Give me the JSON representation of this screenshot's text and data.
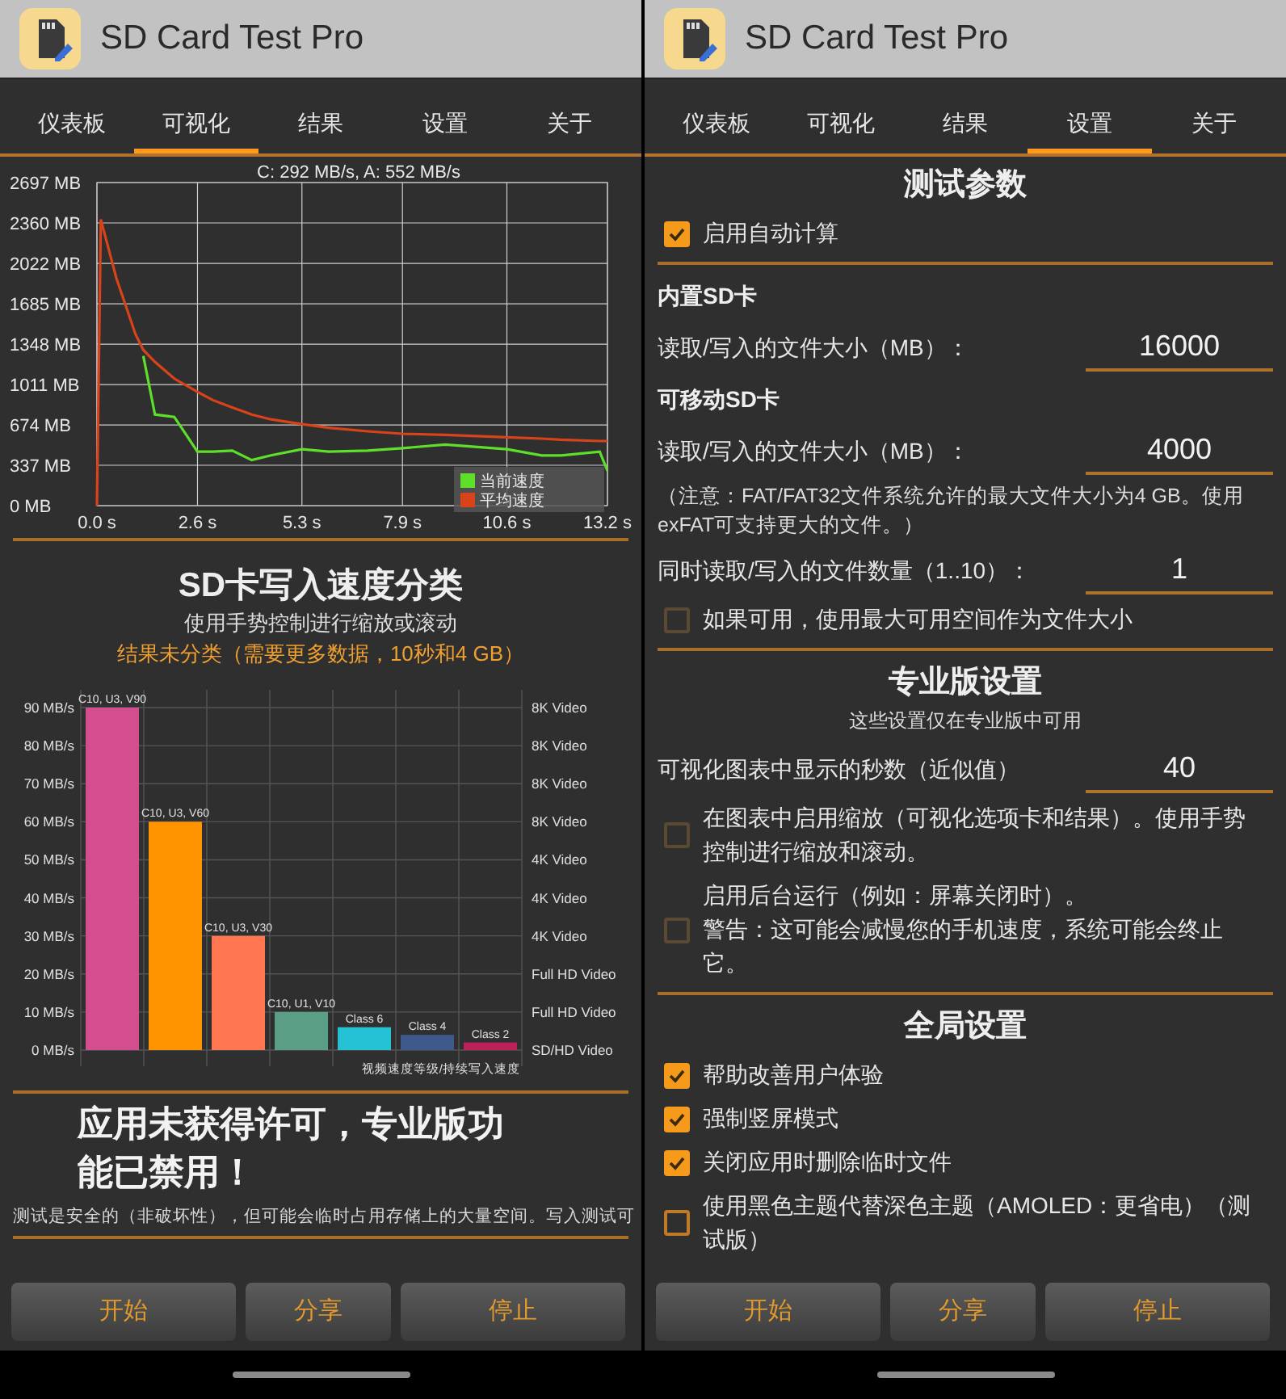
{
  "panels": [
    {
      "kind": "visualize",
      "app_title": "SD Card Test Pro",
      "tabs": [
        {
          "label": "仪表板",
          "selected": false
        },
        {
          "label": "可视化",
          "selected": true
        },
        {
          "label": "结果",
          "selected": false
        },
        {
          "label": "设置",
          "selected": false
        },
        {
          "label": "关于",
          "selected": false
        }
      ],
      "line_chart": {
        "chart_data": {
          "type": "line",
          "title": "C: 292 MB/s, A: 552 MB/s",
          "grid": true,
          "legend": true,
          "x": [
            0,
            0.1,
            0.5,
            1,
            1.2,
            1.5,
            2,
            2.6,
            3,
            3.5,
            4,
            4.5,
            5.3,
            6,
            7,
            7.9,
            9,
            10.6,
            11.5,
            12,
            13,
            13.2
          ],
          "xlim": [
            0,
            13.2
          ],
          "ylim": [
            0,
            2697
          ],
          "xticks": [
            {
              "value": 0,
              "label": "0.0 s"
            },
            {
              "value": 2.6,
              "label": "2.6 s"
            },
            {
              "value": 5.3,
              "label": "5.3 s"
            },
            {
              "value": 7.9,
              "label": "7.9 s"
            },
            {
              "value": 10.6,
              "label": "10.6 s"
            },
            {
              "value": 13.2,
              "label": "13.2 s"
            }
          ],
          "yticks": [
            {
              "value": 0,
              "label": "0 MB"
            },
            {
              "value": 337,
              "label": "337 MB"
            },
            {
              "value": 674,
              "label": "674 MB"
            },
            {
              "value": 1011,
              "label": "1011 MB"
            },
            {
              "value": 1348,
              "label": "1348 MB"
            },
            {
              "value": 1685,
              "label": "1685 MB"
            },
            {
              "value": 2022,
              "label": "2022 MB"
            },
            {
              "value": 2360,
              "label": "2360 MB"
            },
            {
              "value": 2697,
              "label": "2697 MB"
            }
          ],
          "series": [
            {
              "name": "当前速度",
              "color": "#5ee02a",
              "values": [
                null,
                null,
                null,
                null,
                1250,
                760,
                740,
                450,
                450,
                460,
                380,
                420,
                470,
                450,
                460,
                480,
                510,
                470,
                420,
                420,
                450,
                290
              ]
            },
            {
              "name": "平均速度",
              "color": "#d9431a",
              "values": [
                0,
                2390,
                1900,
                1430,
                1300,
                1200,
                1060,
                950,
                880,
                820,
                760,
                720,
                680,
                650,
                620,
                600,
                590,
                570,
                560,
                550,
                540,
                540
              ]
            }
          ]
        }
      },
      "bar_section": {
        "title": "SD卡写入速度分类",
        "subtitle": "使用手势控制进行缩放或滚动",
        "note": "结果未分类（需要更多数据，10秒和4 GB）",
        "chart_data": {
          "type": "bar",
          "grid": true,
          "xlabel": "视频速度等级/持续写入速度",
          "categories": [
            "C10, U3, V90",
            "C10, U3, V60",
            "C10, U3, V30",
            "C10, U1, V10",
            "Class 6",
            "Class 4",
            "Class 2"
          ],
          "colors": [
            "#d44d8e",
            "#ff9400",
            "#ff7650",
            "#5a9f85",
            "#25c2d6",
            "#3d5a8a",
            "#c0205a"
          ],
          "ylim": [
            0,
            90
          ],
          "yticks": [
            {
              "value": 0,
              "label": "0 MB/s"
            },
            {
              "value": 10,
              "label": "10 MB/s"
            },
            {
              "value": 20,
              "label": "20 MB/s"
            },
            {
              "value": 30,
              "label": "30 MB/s"
            },
            {
              "value": 40,
              "label": "40 MB/s"
            },
            {
              "value": 50,
              "label": "50 MB/s"
            },
            {
              "value": 60,
              "label": "60 MB/s"
            },
            {
              "value": 70,
              "label": "70 MB/s"
            },
            {
              "value": 80,
              "label": "80 MB/s"
            },
            {
              "value": 90,
              "label": "90 MB/s"
            }
          ],
          "annotations": [
            "SD/HD Video",
            "Full HD Video",
            "Full HD Video",
            "4K Video",
            "4K Video",
            "4K Video",
            "8K Video",
            "8K Video",
            "8K Video",
            "8K Video"
          ],
          "series": [
            {
              "values": [
                90,
                60,
                30,
                10,
                6,
                4,
                2
              ]
            }
          ]
        }
      },
      "license_warning": {
        "title": "应用未获得许可，专业版功能已禁用！",
        "detail": "测试是安全的（非破坏性），但可能会临时占用存储上的大量空间。写入测试可"
      },
      "buttons": [
        "开始",
        "分享",
        "停止"
      ]
    },
    {
      "kind": "settings",
      "app_title": "SD Card Test Pro",
      "tabs": [
        {
          "label": "仪表板",
          "selected": false
        },
        {
          "label": "可视化",
          "selected": false
        },
        {
          "label": "结果",
          "selected": false
        },
        {
          "label": "设置",
          "selected": true
        },
        {
          "label": "关于",
          "selected": false
        }
      ],
      "items": [
        {
          "kind": "heading",
          "text": "测试参数"
        },
        {
          "kind": "checkbox",
          "label": "启用自动计算",
          "checked": true,
          "disabled": false
        },
        {
          "kind": "divider"
        },
        {
          "kind": "label",
          "text": "内置SD卡"
        },
        {
          "kind": "field",
          "label": "读取/写入的文件大小（MB）：",
          "value": "16000"
        },
        {
          "kind": "label",
          "text": "可移动SD卡"
        },
        {
          "kind": "field",
          "label": "读取/写入的文件大小（MB）：",
          "value": "4000"
        },
        {
          "kind": "note",
          "text": "（注意：FAT/FAT32文件系统允许的最大文件大小为4 GB。使用exFAT可支持更大的文件。）"
        },
        {
          "kind": "field",
          "label": "同时读取/写入的文件数量（1..10）：",
          "value": "1"
        },
        {
          "kind": "checkbox",
          "label": "如果可用，使用最大可用空间作为文件大小",
          "checked": false,
          "disabled": true
        },
        {
          "kind": "divider"
        },
        {
          "kind": "heading",
          "text": "专业版设置"
        },
        {
          "kind": "subheading",
          "text": "这些设置仅在专业版中可用"
        },
        {
          "kind": "field",
          "label": "可视化图表中显示的秒数（近似值）",
          "value": "40"
        },
        {
          "kind": "checkbox",
          "label": "在图表中启用缩放（可视化选项卡和结果）。使用手势控制进行缩放和滚动。",
          "checked": false,
          "disabled": true
        },
        {
          "kind": "checkbox",
          "label": "启用后台运行（例如：屏幕关闭时）。",
          "warning": "警告：这可能会减慢您的手机速度，系统可能会终止它。",
          "checked": false,
          "disabled": true
        },
        {
          "kind": "divider"
        },
        {
          "kind": "heading",
          "text": "全局设置"
        },
        {
          "kind": "checkbox",
          "label": "帮助改善用户体验",
          "checked": true,
          "disabled": false
        },
        {
          "kind": "checkbox",
          "label": "强制竖屏模式",
          "checked": true,
          "disabled": false
        },
        {
          "kind": "checkbox",
          "label": "关闭应用时删除临时文件",
          "checked": true,
          "disabled": false
        },
        {
          "kind": "checkbox",
          "label": "使用黑色主题代替深色主题（AMOLED：更省电）（测试版）",
          "checked": false,
          "disabled": false
        }
      ],
      "buttons": [
        "开始",
        "分享",
        "停止"
      ]
    }
  ]
}
